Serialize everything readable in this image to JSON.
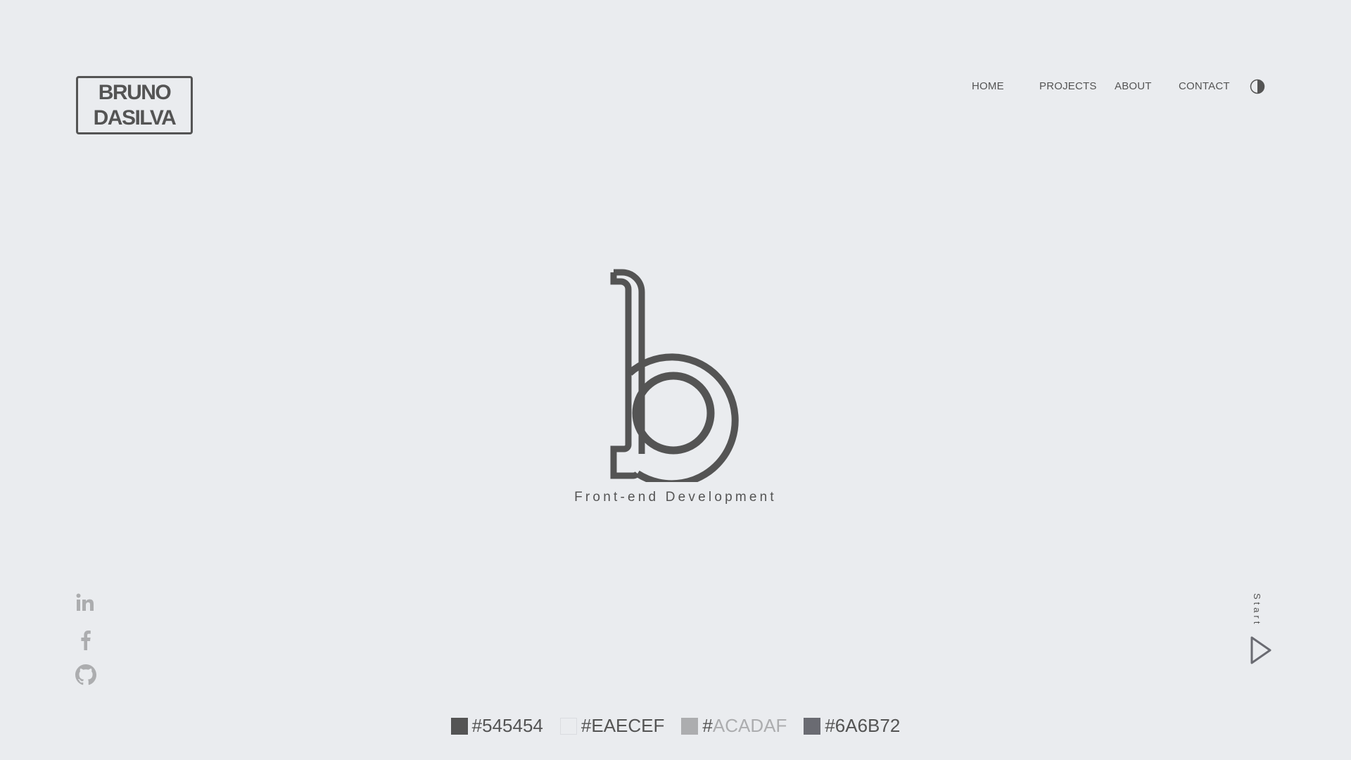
{
  "brand": {
    "line1": "BRUNO",
    "line2": "DASILVA"
  },
  "nav": {
    "items": [
      {
        "label": "HOME"
      },
      {
        "label": "PROJECTS"
      },
      {
        "label": "ABOUT"
      },
      {
        "label": "CONTACT"
      }
    ],
    "theme_icon": "half-circle-contrast-icon"
  },
  "hero": {
    "logo_icon": "b-monogram-logo",
    "tagline": "Front-end Development"
  },
  "social": {
    "icons": [
      "linkedin-icon",
      "facebook-icon",
      "github-icon"
    ],
    "color": "#ACADAF"
  },
  "start": {
    "label": "Start",
    "icon": "play-triangle-icon"
  },
  "palette": [
    {
      "hash": "#",
      "code": "545454",
      "color": "#545454",
      "text_color": "#545454"
    },
    {
      "hash": "#",
      "code": "EAECEF",
      "color": "#EAECEF",
      "text_color": "#545454"
    },
    {
      "hash": "#",
      "code": "ACADAF",
      "color": "#ACADAF",
      "text_color": "#ACADAF"
    },
    {
      "hash": "#",
      "code": "6A6B72",
      "color": "#6A6B72",
      "text_color": "#545454"
    }
  ],
  "colors": {
    "background": "#EAECEF",
    "primary": "#545454",
    "muted": "#ACADAF",
    "secondary": "#6A6B72"
  }
}
